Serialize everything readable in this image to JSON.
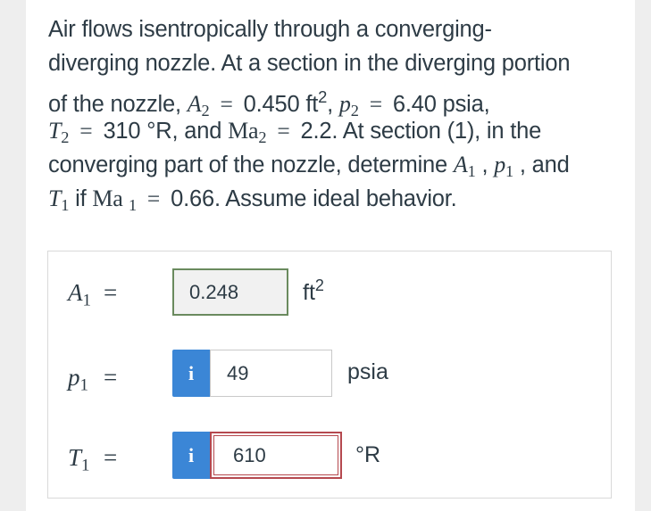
{
  "question": {
    "line1": "Air flows isentropically through a converging-",
    "line2": "diverging nozzle. At a section in the diverging portion",
    "line3_a": "of the nozzle, ",
    "line3_sym": "A",
    "line3_sub": "2",
    "line3_eq": "=",
    "line3_b": "0.450 ft",
    "line3_sup": "2",
    "line3_c": ", ",
    "line3_psym": "p",
    "line3_psub": "2",
    "line3_peq": "=",
    "line3_d": "6.40 psia,",
    "line4_sym": "T",
    "line4_sub": "2",
    "line4_eq": "=",
    "line4_a": "310 °R, and ",
    "line4_masym": "Ma",
    "line4_masub": "2",
    "line4_maeq": "=",
    "line4_b": "2.2. At section (1), in the",
    "line5_a": "converging part of the nozzle, determine ",
    "line5_A": "A",
    "line5_Asub": "1",
    "line5_sep1": " , ",
    "line5_p": "p",
    "line5_psub": "1",
    "line5_b": " , and",
    "line6_T": "T",
    "line6_Tsub": "1",
    "line6_if": " if ",
    "line6_Ma": "Ma ",
    "line6_Masub": "1",
    "line6_eq": "=",
    "line6_b": "0.66. Assume ideal behavior."
  },
  "answers": [
    {
      "symbol": "A",
      "sub": "1",
      "eq": "=",
      "value": "0.248",
      "unit": "ft",
      "unit_sup": "2",
      "state": "correct"
    },
    {
      "symbol": "p",
      "sub": "1",
      "eq": "=",
      "info_label": "i",
      "value": "49",
      "unit": "psia",
      "state": "neutral"
    },
    {
      "symbol": "T",
      "sub": "1",
      "eq": "=",
      "info_label": "i",
      "value": "610",
      "unit": "°R",
      "state": "incorrect"
    }
  ],
  "colors": {
    "text": "#2d3b45",
    "info_button": "#3b86d6",
    "correct_border": "#6a8a5e",
    "incorrect_border": "#b5494f"
  },
  "icons": [
    "info-icon"
  ]
}
